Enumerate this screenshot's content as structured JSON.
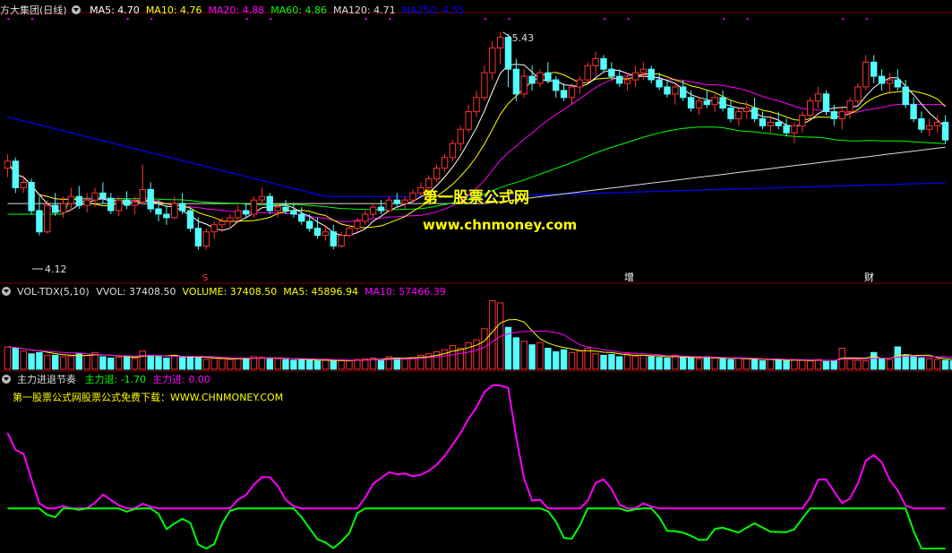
{
  "panel1": {
    "stock": "方大集团(日线)",
    "items": [
      {
        "label": "MA5: 4.70",
        "color": "#ffffff"
      },
      {
        "label": "MA10: 4.76",
        "color": "#ffff00"
      },
      {
        "label": "MA20: 4.88",
        "color": "#ff00ff"
      },
      {
        "label": "MA60: 4.86",
        "color": "#00ff00"
      },
      {
        "label": "MA120: 4.71",
        "color": "#dddddd"
      },
      {
        "label": "MA250: 4.55",
        "color": "#0000ff"
      }
    ],
    "high_label": "5.43",
    "low_label": "4.12",
    "marker_s": "S",
    "marker_zeng": "增",
    "marker_cai": "财",
    "watermark_cn": "第一股票公式网",
    "watermark_url": "www.chnmoney.com"
  },
  "panel2": {
    "indicator": "VOL-TDX(5,10)",
    "items": [
      {
        "label": "VVOL: 37408.50",
        "color": "#dddddd"
      },
      {
        "label": "VOLUME: 37408.50",
        "color": "#ffff00"
      },
      {
        "label": "MA5: 45896.94",
        "color": "#ffff00"
      },
      {
        "label": "MA10: 57466.39",
        "color": "#ff00ff"
      }
    ]
  },
  "panel3": {
    "indicator": "主力进退节奏",
    "items": [
      {
        "label": "主力退: -1.70",
        "color": "#00ff00"
      },
      {
        "label": "主力进: 0.00",
        "color": "#ff00ff"
      }
    ],
    "note": "第一股票公式网股票公式免费下载：WWW.CHNMONEY.COM"
  },
  "colors": {
    "up": "#ff3232",
    "down": "#54fcfc",
    "ma5": "#ffffff",
    "ma10": "#ffff00",
    "ma20": "#ff00ff",
    "ma60": "#00ff00",
    "ma120": "#dddddd",
    "ma250": "#0000ff",
    "grid": "#800000"
  },
  "chart_data": [
    {
      "type": "candlestick",
      "title": "方大集团(日线)",
      "ylim": [
        4.05,
        5.5
      ],
      "annotations": [
        "5.43",
        "4.12"
      ],
      "bars": [
        [
          4.66,
          4.74,
          4.61,
          4.7
        ],
        [
          4.7,
          4.72,
          4.52,
          4.55
        ],
        [
          4.55,
          4.62,
          4.52,
          4.58
        ],
        [
          4.58,
          4.6,
          4.4,
          4.42
        ],
        [
          4.42,
          4.5,
          4.28,
          4.3
        ],
        [
          4.3,
          4.48,
          4.29,
          4.45
        ],
        [
          4.45,
          4.52,
          4.39,
          4.41
        ],
        [
          4.41,
          4.5,
          4.38,
          4.46
        ],
        [
          4.46,
          4.55,
          4.42,
          4.5
        ],
        [
          4.5,
          4.56,
          4.43,
          4.45
        ],
        [
          4.45,
          4.52,
          4.41,
          4.48
        ],
        [
          4.48,
          4.55,
          4.44,
          4.52
        ],
        [
          4.52,
          4.58,
          4.46,
          4.49
        ],
        [
          4.49,
          4.52,
          4.4,
          4.42
        ],
        [
          4.42,
          4.5,
          4.39,
          4.48
        ],
        [
          4.48,
          4.53,
          4.43,
          4.45
        ],
        [
          4.45,
          4.5,
          4.4,
          4.47
        ],
        [
          4.47,
          4.68,
          4.46,
          4.54
        ],
        [
          4.54,
          4.58,
          4.41,
          4.43
        ],
        [
          4.43,
          4.48,
          4.36,
          4.4
        ],
        [
          4.4,
          4.45,
          4.34,
          4.38
        ],
        [
          4.38,
          4.5,
          4.37,
          4.46
        ],
        [
          4.46,
          4.52,
          4.4,
          4.42
        ],
        [
          4.42,
          4.44,
          4.3,
          4.32
        ],
        [
          4.32,
          4.38,
          4.2,
          4.22
        ],
        [
          4.22,
          4.32,
          4.2,
          4.3
        ],
        [
          4.3,
          4.36,
          4.26,
          4.34
        ],
        [
          4.34,
          4.38,
          4.3,
          4.36
        ],
        [
          4.36,
          4.4,
          4.32,
          4.38
        ],
        [
          4.38,
          4.45,
          4.35,
          4.42
        ],
        [
          4.42,
          4.46,
          4.38,
          4.4
        ],
        [
          4.4,
          4.5,
          4.38,
          4.48
        ],
        [
          4.48,
          4.55,
          4.45,
          4.5
        ],
        [
          4.5,
          4.52,
          4.4,
          4.42
        ],
        [
          4.42,
          4.46,
          4.38,
          4.44
        ],
        [
          4.44,
          4.48,
          4.4,
          4.42
        ],
        [
          4.42,
          4.46,
          4.38,
          4.4
        ],
        [
          4.4,
          4.44,
          4.34,
          4.36
        ],
        [
          4.36,
          4.4,
          4.3,
          4.32
        ],
        [
          4.32,
          4.38,
          4.26,
          4.28
        ],
        [
          4.28,
          4.34,
          4.25,
          4.3
        ],
        [
          4.3,
          4.34,
          4.2,
          4.22
        ],
        [
          4.22,
          4.3,
          4.21,
          4.28
        ],
        [
          4.28,
          4.34,
          4.27,
          4.32
        ],
        [
          4.32,
          4.38,
          4.3,
          4.36
        ],
        [
          4.36,
          4.42,
          4.34,
          4.4
        ],
        [
          4.4,
          4.46,
          4.38,
          4.44
        ],
        [
          4.44,
          4.48,
          4.4,
          4.42
        ],
        [
          4.42,
          4.5,
          4.41,
          4.48
        ],
        [
          4.48,
          4.52,
          4.44,
          4.46
        ],
        [
          4.46,
          4.5,
          4.43,
          4.48
        ],
        [
          4.48,
          4.54,
          4.46,
          4.52
        ],
        [
          4.52,
          4.58,
          4.5,
          4.55
        ],
        [
          4.55,
          4.62,
          4.53,
          4.6
        ],
        [
          4.6,
          4.68,
          4.58,
          4.66
        ],
        [
          4.66,
          4.74,
          4.64,
          4.72
        ],
        [
          4.72,
          4.82,
          4.7,
          4.8
        ],
        [
          4.8,
          4.9,
          4.76,
          4.88
        ],
        [
          4.88,
          5.02,
          4.86,
          4.98
        ],
        [
          4.98,
          5.1,
          4.95,
          5.06
        ],
        [
          5.06,
          5.24,
          5.04,
          5.2
        ],
        [
          5.2,
          5.38,
          5.16,
          5.34
        ],
        [
          5.34,
          5.43,
          5.25,
          5.4
        ],
        [
          5.4,
          5.42,
          5.12,
          5.22
        ],
        [
          5.22,
          5.28,
          5.04,
          5.08
        ],
        [
          5.08,
          5.22,
          5.06,
          5.18
        ],
        [
          5.18,
          5.24,
          5.1,
          5.14
        ],
        [
          5.14,
          5.22,
          5.12,
          5.2
        ],
        [
          5.2,
          5.26,
          5.14,
          5.16
        ],
        [
          5.16,
          5.18,
          5.06,
          5.1
        ],
        [
          5.1,
          5.14,
          5.04,
          5.06
        ],
        [
          5.06,
          5.14,
          5.02,
          5.12
        ],
        [
          5.12,
          5.18,
          5.08,
          5.16
        ],
        [
          5.16,
          5.26,
          5.14,
          5.24
        ],
        [
          5.24,
          5.32,
          5.18,
          5.28
        ],
        [
          5.28,
          5.3,
          5.2,
          5.22
        ],
        [
          5.22,
          5.26,
          5.16,
          5.18
        ],
        [
          5.18,
          5.22,
          5.12,
          5.14
        ],
        [
          5.14,
          5.2,
          5.1,
          5.16
        ],
        [
          5.16,
          5.24,
          5.12,
          5.2
        ],
        [
          5.2,
          5.26,
          5.16,
          5.22
        ],
        [
          5.22,
          5.24,
          5.14,
          5.16
        ],
        [
          5.16,
          5.2,
          5.1,
          5.12
        ],
        [
          5.12,
          5.16,
          5.06,
          5.08
        ],
        [
          5.08,
          5.14,
          5.02,
          5.12
        ],
        [
          5.12,
          5.16,
          5.04,
          5.06
        ],
        [
          5.06,
          5.1,
          4.98,
          5.0
        ],
        [
          5.0,
          5.06,
          4.96,
          5.04
        ],
        [
          5.04,
          5.1,
          5.0,
          5.02
        ],
        [
          5.02,
          5.08,
          4.98,
          5.06
        ],
        [
          5.06,
          5.1,
          4.98,
          5.0
        ],
        [
          5.0,
          5.04,
          4.92,
          4.94
        ],
        [
          4.94,
          5.0,
          4.9,
          4.98
        ],
        [
          4.98,
          5.04,
          4.94,
          5.0
        ],
        [
          5.0,
          5.06,
          4.92,
          4.94
        ],
        [
          4.94,
          4.98,
          4.88,
          4.9
        ],
        [
          4.9,
          4.96,
          4.86,
          4.92
        ],
        [
          4.92,
          4.98,
          4.88,
          4.9
        ],
        [
          4.9,
          4.94,
          4.84,
          4.86
        ],
        [
          4.86,
          4.92,
          4.8,
          4.9
        ],
        [
          4.9,
          4.98,
          4.86,
          4.96
        ],
        [
          4.96,
          5.06,
          4.94,
          5.04
        ],
        [
          5.04,
          5.12,
          5.0,
          5.08
        ],
        [
          5.08,
          5.1,
          4.96,
          4.98
        ],
        [
          4.98,
          5.02,
          4.9,
          4.94
        ],
        [
          4.94,
          5.0,
          4.88,
          4.98
        ],
        [
          4.98,
          5.06,
          4.94,
          5.04
        ],
        [
          5.04,
          5.14,
          5.02,
          5.12
        ],
        [
          5.12,
          5.3,
          5.1,
          5.26
        ],
        [
          5.26,
          5.3,
          5.14,
          5.18
        ],
        [
          5.18,
          5.22,
          5.1,
          5.14
        ],
        [
          5.14,
          5.2,
          5.08,
          5.16
        ],
        [
          5.16,
          5.22,
          5.1,
          5.12
        ],
        [
          5.12,
          5.16,
          5.0,
          5.02
        ],
        [
          5.02,
          5.06,
          4.92,
          4.94
        ],
        [
          4.94,
          4.98,
          4.86,
          4.88
        ],
        [
          4.88,
          4.94,
          4.84,
          4.9
        ],
        [
          4.9,
          4.96,
          4.86,
          4.92
        ],
        [
          4.92,
          4.96,
          4.8,
          4.82
        ]
      ]
    },
    {
      "type": "bar",
      "title": "VOL-TDX(5,10)",
      "ylim": [
        0,
        1.0
      ],
      "values": [
        0.32,
        0.3,
        0.26,
        0.22,
        0.24,
        0.2,
        0.2,
        0.18,
        0.19,
        0.22,
        0.2,
        0.24,
        0.18,
        0.16,
        0.17,
        0.18,
        0.16,
        0.26,
        0.2,
        0.18,
        0.16,
        0.2,
        0.17,
        0.18,
        0.16,
        0.14,
        0.16,
        0.15,
        0.14,
        0.16,
        0.15,
        0.18,
        0.17,
        0.16,
        0.15,
        0.14,
        0.13,
        0.14,
        0.13,
        0.12,
        0.13,
        0.12,
        0.13,
        0.12,
        0.14,
        0.15,
        0.16,
        0.14,
        0.18,
        0.16,
        0.15,
        0.17,
        0.2,
        0.22,
        0.25,
        0.28,
        0.34,
        0.3,
        0.38,
        0.42,
        0.58,
        0.98,
        0.95,
        0.6,
        0.45,
        0.4,
        0.35,
        0.38,
        0.3,
        0.25,
        0.28,
        0.24,
        0.26,
        0.3,
        0.22,
        0.2,
        0.21,
        0.18,
        0.22,
        0.19,
        0.2,
        0.18,
        0.17,
        0.16,
        0.2,
        0.17,
        0.16,
        0.15,
        0.18,
        0.16,
        0.15,
        0.14,
        0.16,
        0.15,
        0.14,
        0.12,
        0.14,
        0.13,
        0.12,
        0.14,
        0.13,
        0.12,
        0.14,
        0.11,
        0.12,
        0.3,
        0.14,
        0.13,
        0.12,
        0.24,
        0.15,
        0.14,
        0.32,
        0.2,
        0.18,
        0.16,
        0.15,
        0.14,
        0.13,
        0.12,
        0.11
      ]
    },
    {
      "type": "line",
      "title": "主力进退节奏",
      "ylim": [
        -1.7,
        5.2
      ],
      "series": [
        {
          "name": "主力退",
          "values": []
        },
        {
          "name": "主力进",
          "values": []
        }
      ]
    }
  ]
}
